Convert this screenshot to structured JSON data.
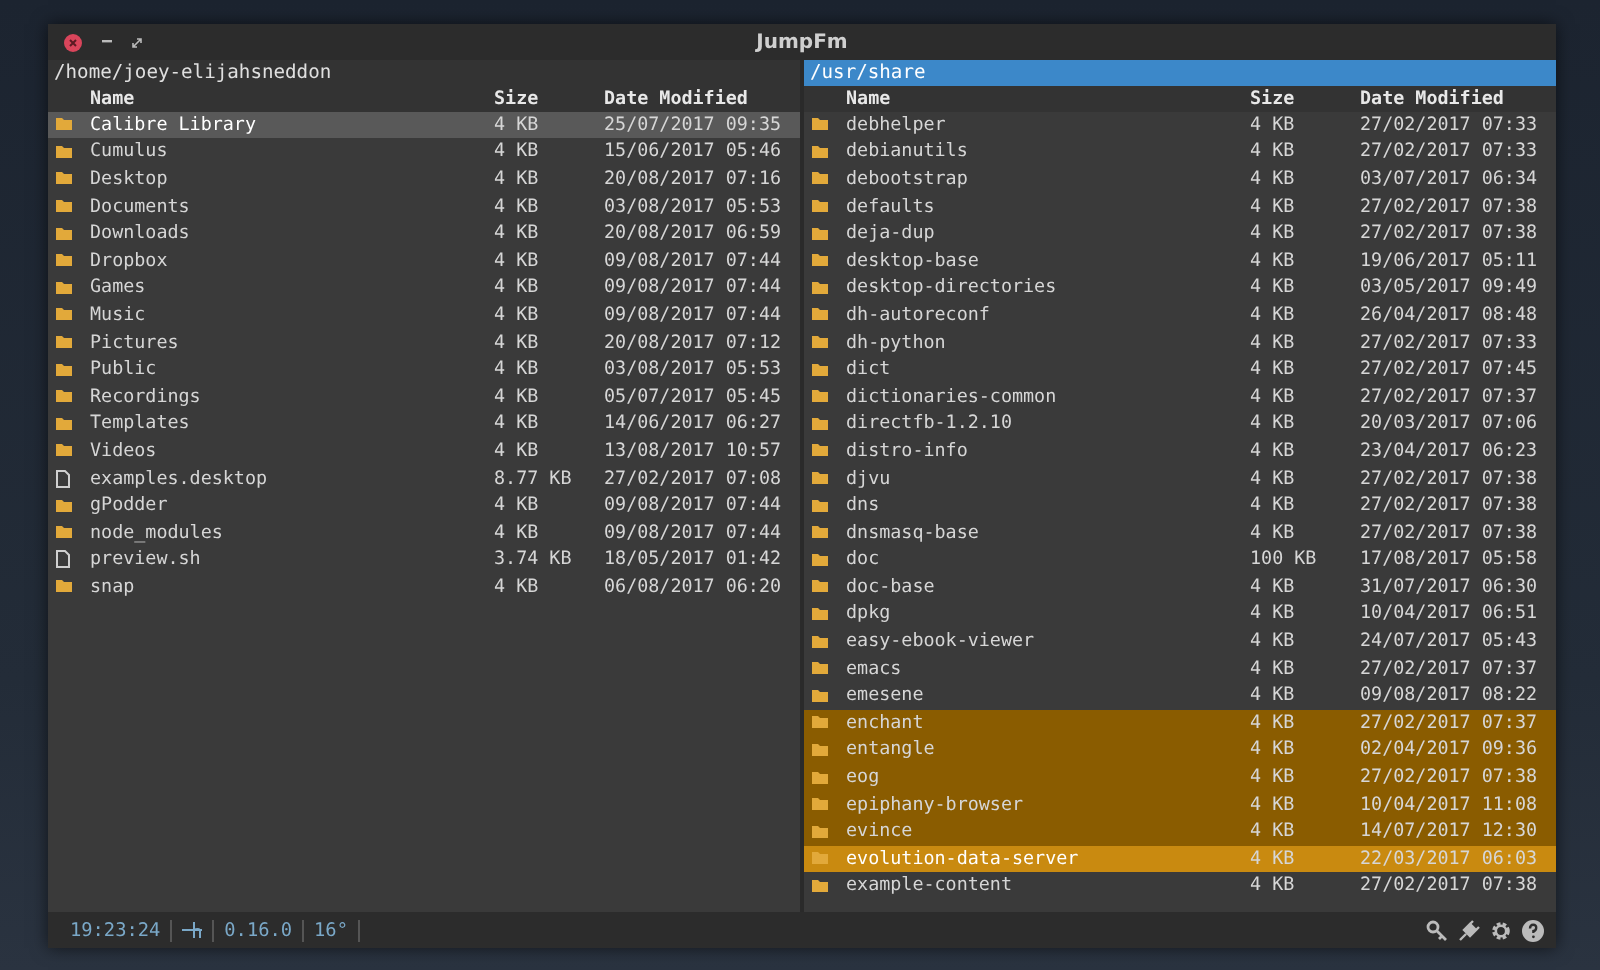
{
  "window": {
    "title": "JumpFm"
  },
  "panes": [
    {
      "path": "/home/joey-elijahsneddon",
      "active": false,
      "columns": [
        "Name",
        "Size",
        "Date Modified"
      ],
      "rows": [
        {
          "kind": "folder",
          "name": "Calibre Library",
          "size": "4 KB",
          "modified": "25/07/2017 09:35",
          "selected": false,
          "cursor": true
        },
        {
          "kind": "folder",
          "name": "Cumulus",
          "size": "4 KB",
          "modified": "15/06/2017 05:46",
          "selected": false,
          "cursor": false
        },
        {
          "kind": "folder",
          "name": "Desktop",
          "size": "4 KB",
          "modified": "20/08/2017 07:16",
          "selected": false,
          "cursor": false
        },
        {
          "kind": "folder",
          "name": "Documents",
          "size": "4 KB",
          "modified": "03/08/2017 05:53",
          "selected": false,
          "cursor": false
        },
        {
          "kind": "folder",
          "name": "Downloads",
          "size": "4 KB",
          "modified": "20/08/2017 06:59",
          "selected": false,
          "cursor": false
        },
        {
          "kind": "folder",
          "name": "Dropbox",
          "size": "4 KB",
          "modified": "09/08/2017 07:44",
          "selected": false,
          "cursor": false
        },
        {
          "kind": "folder",
          "name": "Games",
          "size": "4 KB",
          "modified": "09/08/2017 07:44",
          "selected": false,
          "cursor": false
        },
        {
          "kind": "folder",
          "name": "Music",
          "size": "4 KB",
          "modified": "09/08/2017 07:44",
          "selected": false,
          "cursor": false
        },
        {
          "kind": "folder",
          "name": "Pictures",
          "size": "4 KB",
          "modified": "20/08/2017 07:12",
          "selected": false,
          "cursor": false
        },
        {
          "kind": "folder",
          "name": "Public",
          "size": "4 KB",
          "modified": "03/08/2017 05:53",
          "selected": false,
          "cursor": false
        },
        {
          "kind": "folder",
          "name": "Recordings",
          "size": "4 KB",
          "modified": "05/07/2017 05:45",
          "selected": false,
          "cursor": false
        },
        {
          "kind": "folder",
          "name": "Templates",
          "size": "4 KB",
          "modified": "14/06/2017 06:27",
          "selected": false,
          "cursor": false
        },
        {
          "kind": "folder",
          "name": "Videos",
          "size": "4 KB",
          "modified": "13/08/2017 10:57",
          "selected": false,
          "cursor": false
        },
        {
          "kind": "file",
          "name": "examples.desktop",
          "size": "8.77 KB",
          "modified": "27/02/2017 07:08",
          "selected": false,
          "cursor": false
        },
        {
          "kind": "folder",
          "name": "gPodder",
          "size": "4 KB",
          "modified": "09/08/2017 07:44",
          "selected": false,
          "cursor": false
        },
        {
          "kind": "folder",
          "name": "node_modules",
          "size": "4 KB",
          "modified": "09/08/2017 07:44",
          "selected": false,
          "cursor": false
        },
        {
          "kind": "file",
          "name": "preview.sh",
          "size": "3.74 KB",
          "modified": "18/05/2017 01:42",
          "selected": false,
          "cursor": false
        },
        {
          "kind": "folder",
          "name": "snap",
          "size": "4 KB",
          "modified": "06/08/2017 06:20",
          "selected": false,
          "cursor": false
        }
      ]
    },
    {
      "path": "/usr/share",
      "active": true,
      "columns": [
        "Name",
        "Size",
        "Date Modified"
      ],
      "rows": [
        {
          "kind": "folder",
          "name": "debhelper",
          "size": "4 KB",
          "modified": "27/02/2017 07:33",
          "selected": false,
          "cursor": false
        },
        {
          "kind": "folder",
          "name": "debianutils",
          "size": "4 KB",
          "modified": "27/02/2017 07:33",
          "selected": false,
          "cursor": false
        },
        {
          "kind": "folder",
          "name": "debootstrap",
          "size": "4 KB",
          "modified": "03/07/2017 06:34",
          "selected": false,
          "cursor": false
        },
        {
          "kind": "folder",
          "name": "defaults",
          "size": "4 KB",
          "modified": "27/02/2017 07:38",
          "selected": false,
          "cursor": false
        },
        {
          "kind": "folder",
          "name": "deja-dup",
          "size": "4 KB",
          "modified": "27/02/2017 07:38",
          "selected": false,
          "cursor": false
        },
        {
          "kind": "folder",
          "name": "desktop-base",
          "size": "4 KB",
          "modified": "19/06/2017 05:11",
          "selected": false,
          "cursor": false
        },
        {
          "kind": "folder",
          "name": "desktop-directories",
          "size": "4 KB",
          "modified": "03/05/2017 09:49",
          "selected": false,
          "cursor": false
        },
        {
          "kind": "folder",
          "name": "dh-autoreconf",
          "size": "4 KB",
          "modified": "26/04/2017 08:48",
          "selected": false,
          "cursor": false
        },
        {
          "kind": "folder",
          "name": "dh-python",
          "size": "4 KB",
          "modified": "27/02/2017 07:33",
          "selected": false,
          "cursor": false
        },
        {
          "kind": "folder",
          "name": "dict",
          "size": "4 KB",
          "modified": "27/02/2017 07:45",
          "selected": false,
          "cursor": false
        },
        {
          "kind": "folder",
          "name": "dictionaries-common",
          "size": "4 KB",
          "modified": "27/02/2017 07:37",
          "selected": false,
          "cursor": false
        },
        {
          "kind": "folder",
          "name": "directfb-1.2.10",
          "size": "4 KB",
          "modified": "20/03/2017 07:06",
          "selected": false,
          "cursor": false
        },
        {
          "kind": "folder",
          "name": "distro-info",
          "size": "4 KB",
          "modified": "23/04/2017 06:23",
          "selected": false,
          "cursor": false
        },
        {
          "kind": "folder",
          "name": "djvu",
          "size": "4 KB",
          "modified": "27/02/2017 07:38",
          "selected": false,
          "cursor": false
        },
        {
          "kind": "folder",
          "name": "dns",
          "size": "4 KB",
          "modified": "27/02/2017 07:38",
          "selected": false,
          "cursor": false
        },
        {
          "kind": "folder",
          "name": "dnsmasq-base",
          "size": "4 KB",
          "modified": "27/02/2017 07:38",
          "selected": false,
          "cursor": false
        },
        {
          "kind": "folder",
          "name": "doc",
          "size": "100 KB",
          "modified": "17/08/2017 05:58",
          "selected": false,
          "cursor": false
        },
        {
          "kind": "folder",
          "name": "doc-base",
          "size": "4 KB",
          "modified": "31/07/2017 06:30",
          "selected": false,
          "cursor": false
        },
        {
          "kind": "folder",
          "name": "dpkg",
          "size": "4 KB",
          "modified": "10/04/2017 06:51",
          "selected": false,
          "cursor": false
        },
        {
          "kind": "folder",
          "name": "easy-ebook-viewer",
          "size": "4 KB",
          "modified": "24/07/2017 05:43",
          "selected": false,
          "cursor": false
        },
        {
          "kind": "folder",
          "name": "emacs",
          "size": "4 KB",
          "modified": "27/02/2017 07:37",
          "selected": false,
          "cursor": false
        },
        {
          "kind": "folder",
          "name": "emesene",
          "size": "4 KB",
          "modified": "09/08/2017 08:22",
          "selected": false,
          "cursor": false
        },
        {
          "kind": "folder",
          "name": "enchant",
          "size": "4 KB",
          "modified": "27/02/2017 07:37",
          "selected": true,
          "cursor": false
        },
        {
          "kind": "folder",
          "name": "entangle",
          "size": "4 KB",
          "modified": "02/04/2017 09:36",
          "selected": true,
          "cursor": false
        },
        {
          "kind": "folder",
          "name": "eog",
          "size": "4 KB",
          "modified": "27/02/2017 07:38",
          "selected": true,
          "cursor": false
        },
        {
          "kind": "folder",
          "name": "epiphany-browser",
          "size": "4 KB",
          "modified": "10/04/2017 11:08",
          "selected": true,
          "cursor": false
        },
        {
          "kind": "folder",
          "name": "evince",
          "size": "4 KB",
          "modified": "14/07/2017 12:30",
          "selected": true,
          "cursor": false
        },
        {
          "kind": "folder",
          "name": "evolution-data-server",
          "size": "4 KB",
          "modified": "22/03/2017 06:03",
          "selected": true,
          "cursor": true
        },
        {
          "kind": "folder",
          "name": "example-content",
          "size": "4 KB",
          "modified": "27/02/2017 07:38",
          "selected": false,
          "cursor": false
        }
      ]
    }
  ],
  "status_bar": {
    "clock": "19:23:24",
    "version": "0.16.0",
    "temperature": "16°"
  }
}
